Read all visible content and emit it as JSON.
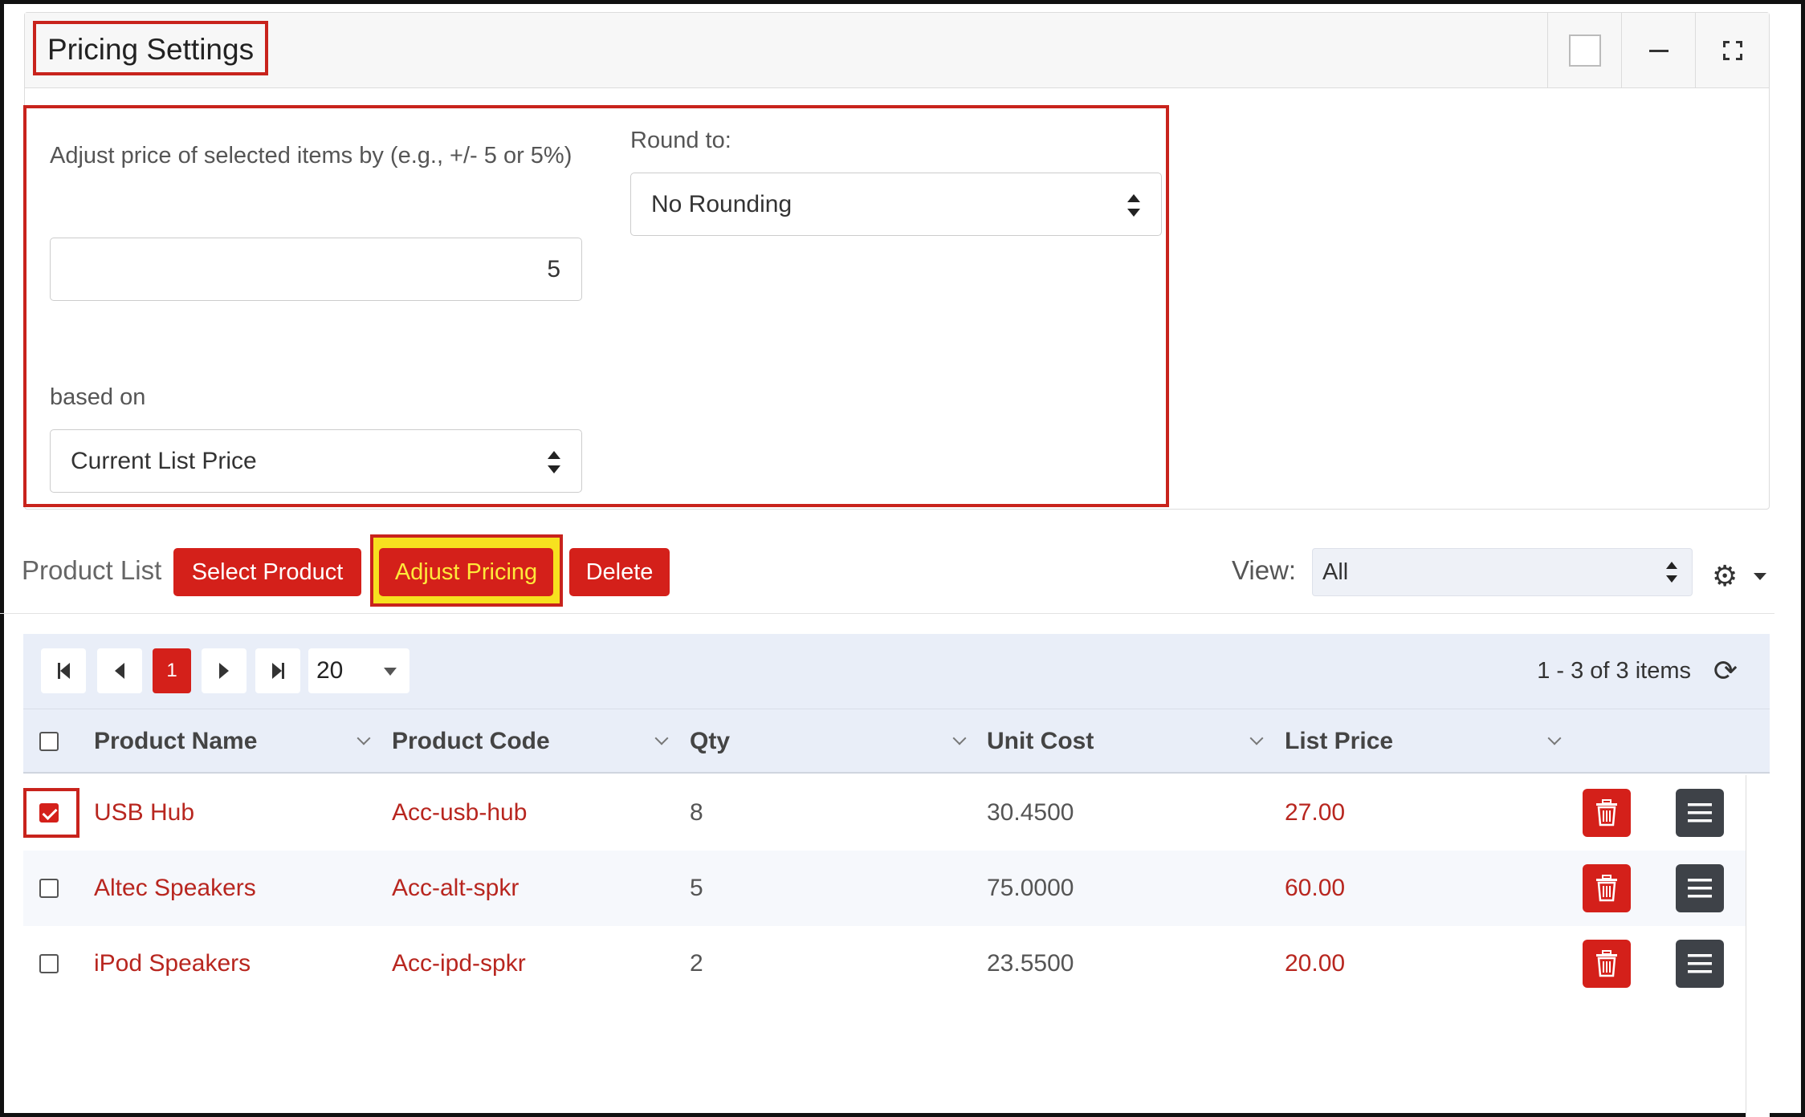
{
  "panel": {
    "title": "Pricing Settings"
  },
  "form": {
    "adjust_label": "Adjust price of selected items by (e.g., +/- 5 or 5%)",
    "adjust_value": "5",
    "round_label": "Round to:",
    "round_value": "No Rounding",
    "based_label": "based on",
    "based_value": "Current List Price"
  },
  "toolbar": {
    "title": "Product List",
    "select_product": "Select Product",
    "adjust_pricing": "Adjust Pricing",
    "delete": "Delete",
    "view_label": "View:",
    "view_value": "All"
  },
  "pager": {
    "current_page": "1",
    "page_size": "20",
    "info": "1 - 3 of 3 items"
  },
  "columns": [
    "Product Name",
    "Product Code",
    "Qty",
    "Unit Cost",
    "List Price"
  ],
  "rows": [
    {
      "checked": true,
      "name": "USB Hub",
      "code": "Acc-usb-hub",
      "qty": "8",
      "unit_cost": "30.4500",
      "list_price": "27.00"
    },
    {
      "checked": false,
      "name": "Altec Speakers",
      "code": "Acc-alt-spkr",
      "qty": "5",
      "unit_cost": "75.0000",
      "list_price": "60.00"
    },
    {
      "checked": false,
      "name": "iPod Speakers",
      "code": "Acc-ipd-spkr",
      "qty": "2",
      "unit_cost": "23.5500",
      "list_price": "20.00"
    }
  ],
  "colors": {
    "accent_red": "#d4201a",
    "highlight_yellow": "#f7e11f",
    "link_red": "#b8261f"
  }
}
